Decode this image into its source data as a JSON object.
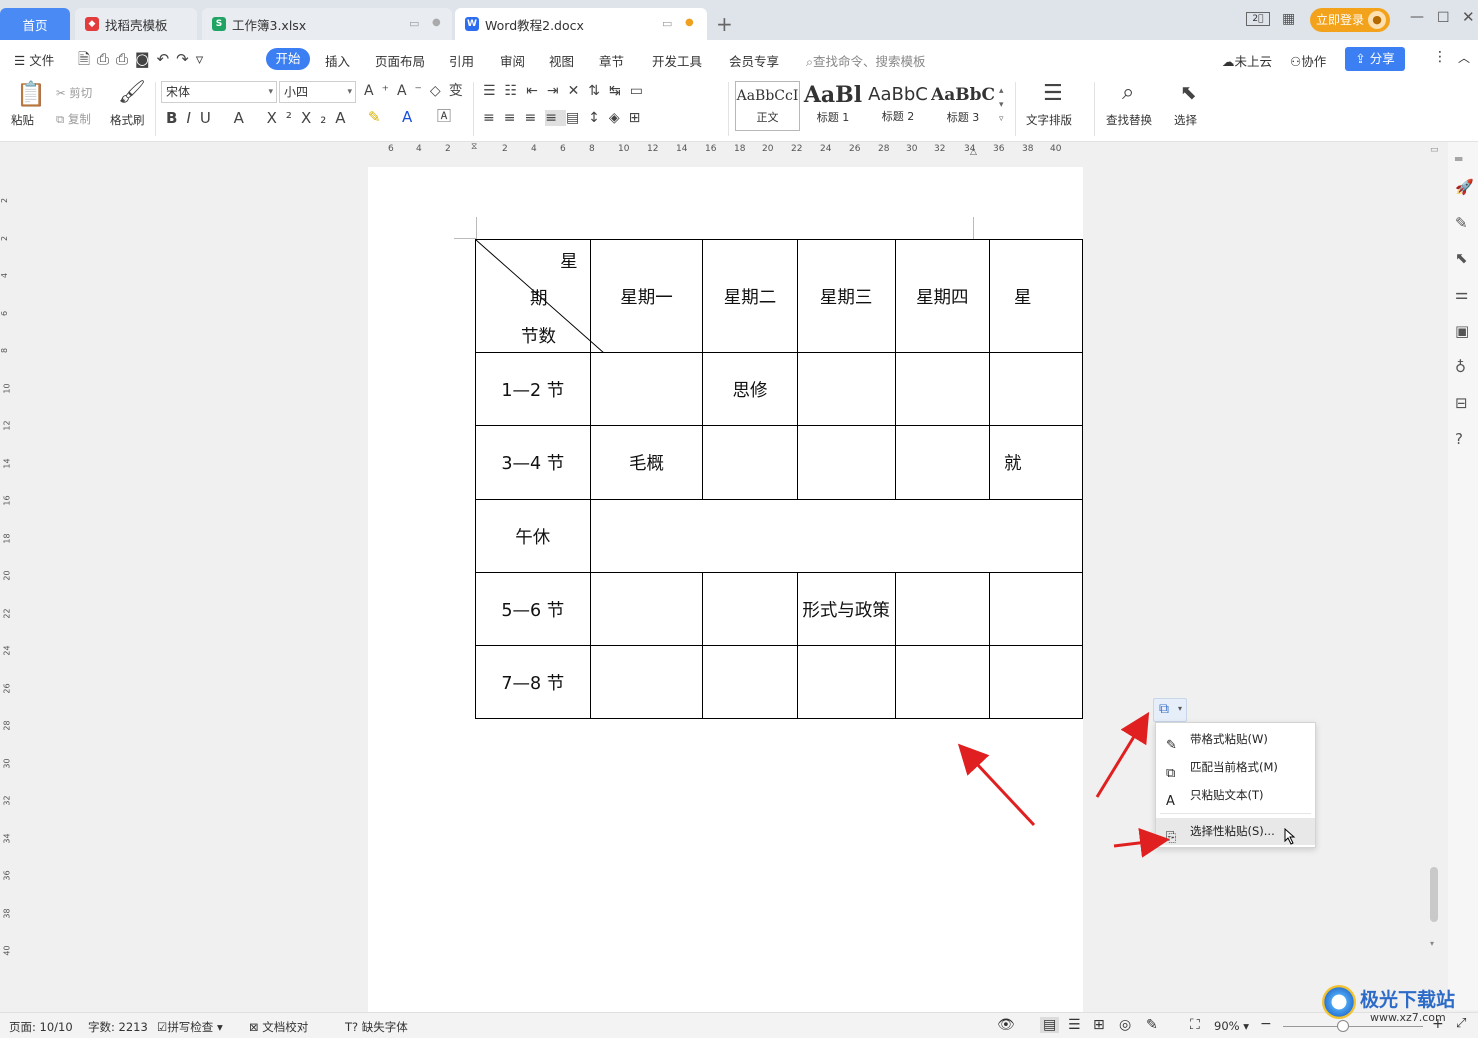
{
  "tabs": {
    "home": "首页",
    "daoke": "找稻壳模板",
    "xlsx": "工作簿3.xlsx",
    "docx": "Word教程2.docx",
    "new_tab": "+"
  },
  "titlebar": {
    "login": "立即登录"
  },
  "menu": {
    "file": "文件",
    "items": [
      "开始",
      "插入",
      "页面布局",
      "引用",
      "审阅",
      "视图",
      "章节",
      "开发工具",
      "会员专享"
    ],
    "search": "查找命令、搜索模板",
    "cloud": "未上云",
    "collab": "协作",
    "share": "分享"
  },
  "ribbon": {
    "paste": "粘贴",
    "cut": "剪切",
    "copy": "复制",
    "format_painter": "格式刷",
    "font_name": "宋体",
    "font_size": "小四",
    "styles": [
      {
        "preview": "AaBbCcI",
        "label": "正文"
      },
      {
        "preview": "AaBl",
        "label": "标题 1"
      },
      {
        "preview": "AaBbC",
        "label": "标题 2"
      },
      {
        "preview": "AaBbC",
        "label": "标题 3"
      }
    ],
    "text_layout": "文字排版",
    "find_replace": "查找替换",
    "select": "选择"
  },
  "ruler": {
    "h": [
      "6",
      "4",
      "2",
      "2",
      "4",
      "6",
      "8",
      "10",
      "12",
      "14",
      "16",
      "18",
      "20",
      "22",
      "24",
      "26",
      "28",
      "30",
      "32",
      "34",
      "36",
      "38",
      "40"
    ],
    "v": [
      "2",
      "2",
      "4",
      "6",
      "8",
      "10",
      "12",
      "14",
      "16",
      "18",
      "20",
      "22",
      "24",
      "26",
      "28",
      "30",
      "32",
      "34",
      "36",
      "38",
      "40"
    ]
  },
  "table": {
    "corner": {
      "top": "星",
      "mid": "期",
      "bottom": "节数"
    },
    "headers": [
      "星期一",
      "星期二",
      "星期三",
      "星期四",
      "星"
    ],
    "rows": [
      {
        "label": "1—2 节",
        "cells": [
          "",
          "思修",
          "",
          "",
          ""
        ]
      },
      {
        "label": "3—4 节",
        "cells": [
          "毛概",
          "",
          "",
          "",
          "就"
        ]
      },
      {
        "label": "午休",
        "cells": []
      },
      {
        "label": "5—6 节",
        "cells": [
          "",
          "",
          "形式与政策",
          "",
          ""
        ]
      },
      {
        "label": "7—8 节",
        "cells": [
          "",
          "",
          "",
          "",
          ""
        ]
      }
    ]
  },
  "paste_menu": {
    "items": [
      "带格式粘贴(W)",
      "匹配当前格式(M)",
      "只粘贴文本(T)",
      "选择性粘贴(S)..."
    ]
  },
  "status": {
    "page": "页面: 10/10",
    "words": "字数: 2213",
    "spell": "拼写检查",
    "proof": "文档校对",
    "missing_font": "缺失字体",
    "zoom": "90%"
  },
  "watermark": {
    "text": "极光下载站",
    "url": "www.xz7.com"
  },
  "colors": {
    "accent": "#3b7ff3",
    "arrow": "#e02020",
    "login": "#f3a21b"
  }
}
